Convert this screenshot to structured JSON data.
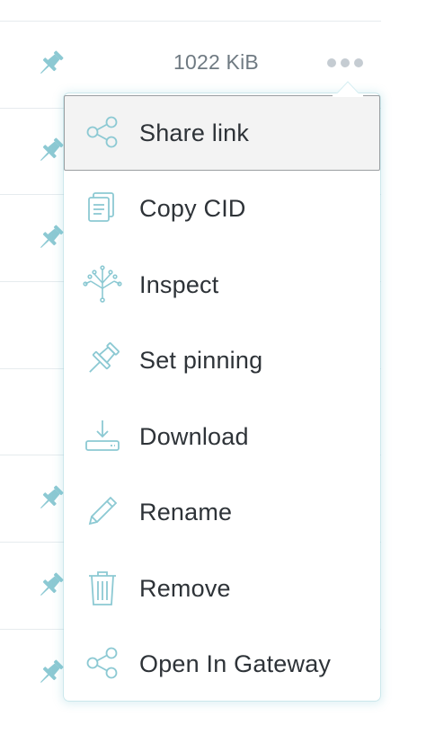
{
  "file_row": {
    "size": "1022 KiB",
    "more_icon": "more-dots-icon",
    "pin_icon": "pin-icon"
  },
  "menu": {
    "items": [
      {
        "label": "Share link",
        "icon": "share-icon",
        "selected": true
      },
      {
        "label": "Copy CID",
        "icon": "copy-icon",
        "selected": false
      },
      {
        "label": "Inspect",
        "icon": "inspect-tree-icon",
        "selected": false
      },
      {
        "label": "Set pinning",
        "icon": "pin-icon",
        "selected": false
      },
      {
        "label": "Download",
        "icon": "download-icon",
        "selected": false
      },
      {
        "label": "Rename",
        "icon": "pencil-icon",
        "selected": false
      },
      {
        "label": "Remove",
        "icon": "trash-icon",
        "selected": false
      },
      {
        "label": "Open In Gateway",
        "icon": "share-icon",
        "selected": false
      }
    ]
  },
  "colors": {
    "icon_teal": "#8cc9d3",
    "text": "#2e3338",
    "muted_text": "#6f7a82",
    "divider": "#e6ebee",
    "selected_bg": "#f3f3f3"
  }
}
